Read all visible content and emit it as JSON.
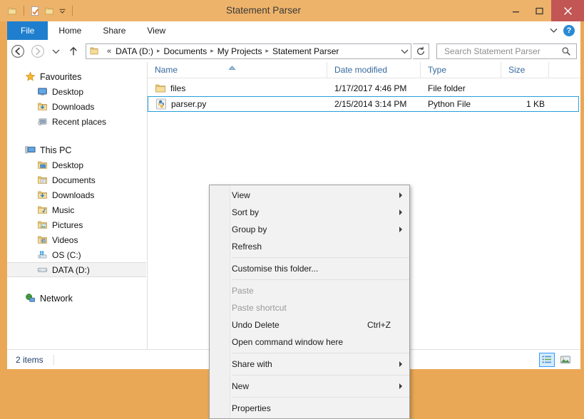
{
  "window": {
    "title": "Statement Parser",
    "controls": {
      "minimize": "minimize-button",
      "maximize": "maximize-button",
      "close": "close-button",
      "close_glyph": "✕"
    },
    "colors": {
      "frame": "#eaa856",
      "titlebar": "#eeb36a",
      "close_button": "#c15654",
      "accent_blue": "#1f7fce",
      "selection_outline": "#26a0da"
    }
  },
  "quick_access": {
    "items": [
      {
        "name": "folder-icon",
        "label": "Folder"
      },
      {
        "name": "properties-icon",
        "label": "Properties"
      },
      {
        "name": "new-folder-icon",
        "label": "New folder"
      },
      {
        "name": "chevron-down-icon",
        "label": "Customize Quick Access Toolbar"
      }
    ]
  },
  "ribbon": {
    "tabs": [
      {
        "label": "File",
        "active": true
      },
      {
        "label": "Home",
        "active": false
      },
      {
        "label": "Share",
        "active": false
      },
      {
        "label": "View",
        "active": false
      }
    ],
    "expand_icon": "chevron-down-icon",
    "help_label": "?"
  },
  "navigation": {
    "back": "back-button",
    "forward": "forward-button",
    "recent": "recent-locations-button",
    "up": "up-button",
    "refresh": "refresh-button",
    "breadcrumb": {
      "overflow": "«",
      "items": [
        "DATA (D:)",
        "Documents",
        "My Projects",
        "Statement Parser"
      ],
      "separator": "▸"
    }
  },
  "search": {
    "placeholder": "Search Statement Parser",
    "value": "",
    "icon": "search-icon"
  },
  "sidebar": {
    "groups": [
      {
        "root": {
          "label": "Favourites",
          "icon": "star-icon"
        },
        "items": [
          {
            "label": "Desktop",
            "icon": "desktop-icon"
          },
          {
            "label": "Downloads",
            "icon": "downloads-folder-icon"
          },
          {
            "label": "Recent places",
            "icon": "recent-places-icon"
          }
        ]
      },
      {
        "root": {
          "label": "This PC",
          "icon": "computer-icon"
        },
        "items": [
          {
            "label": "Desktop",
            "icon": "desktop-folder-icon"
          },
          {
            "label": "Documents",
            "icon": "documents-folder-icon"
          },
          {
            "label": "Downloads",
            "icon": "downloads-folder-icon"
          },
          {
            "label": "Music",
            "icon": "music-folder-icon"
          },
          {
            "label": "Pictures",
            "icon": "pictures-folder-icon"
          },
          {
            "label": "Videos",
            "icon": "videos-folder-icon"
          },
          {
            "label": "OS (C:)",
            "icon": "system-drive-icon"
          },
          {
            "label": "DATA (D:)",
            "icon": "drive-icon",
            "selected": true
          }
        ]
      },
      {
        "root": {
          "label": "Network",
          "icon": "network-icon"
        },
        "items": []
      }
    ]
  },
  "file_list": {
    "columns": [
      {
        "label": "Name",
        "sorted": "ascending"
      },
      {
        "label": "Date modified"
      },
      {
        "label": "Type"
      },
      {
        "label": "Size"
      }
    ],
    "rows": [
      {
        "name": "files",
        "date_modified": "1/17/2017 4:46 PM",
        "type": "File folder",
        "size": "",
        "icon": "folder-icon",
        "selected": false
      },
      {
        "name": "parser.py",
        "date_modified": "2/15/2014 3:14 PM",
        "type": "Python File",
        "size": "1 KB",
        "icon": "python-file-icon",
        "selected": true
      }
    ]
  },
  "context_menu": {
    "items": [
      {
        "label": "View",
        "submenu": true,
        "disabled": false,
        "accel": ""
      },
      {
        "label": "Sort by",
        "submenu": true,
        "disabled": false,
        "accel": ""
      },
      {
        "label": "Group by",
        "submenu": true,
        "disabled": false,
        "accel": ""
      },
      {
        "label": "Refresh",
        "submenu": false,
        "disabled": false,
        "accel": ""
      },
      {
        "separator": true
      },
      {
        "label": "Customise this folder...",
        "submenu": false,
        "disabled": false,
        "accel": ""
      },
      {
        "separator": true
      },
      {
        "label": "Paste",
        "submenu": false,
        "disabled": true,
        "accel": ""
      },
      {
        "label": "Paste shortcut",
        "submenu": false,
        "disabled": true,
        "accel": ""
      },
      {
        "label": "Undo Delete",
        "submenu": false,
        "disabled": false,
        "accel": "Ctrl+Z"
      },
      {
        "label": "Open command window here",
        "submenu": false,
        "disabled": false,
        "accel": ""
      },
      {
        "separator": true
      },
      {
        "label": "Share with",
        "submenu": true,
        "disabled": false,
        "accel": ""
      },
      {
        "separator": true
      },
      {
        "label": "New",
        "submenu": true,
        "disabled": false,
        "accel": ""
      },
      {
        "separator": true
      },
      {
        "label": "Properties",
        "submenu": false,
        "disabled": false,
        "accel": ""
      }
    ]
  },
  "status_bar": {
    "item_count": "2 items",
    "view_buttons": [
      {
        "name": "details-view-button",
        "active": true
      },
      {
        "name": "large-icons-view-button",
        "active": false
      }
    ]
  }
}
